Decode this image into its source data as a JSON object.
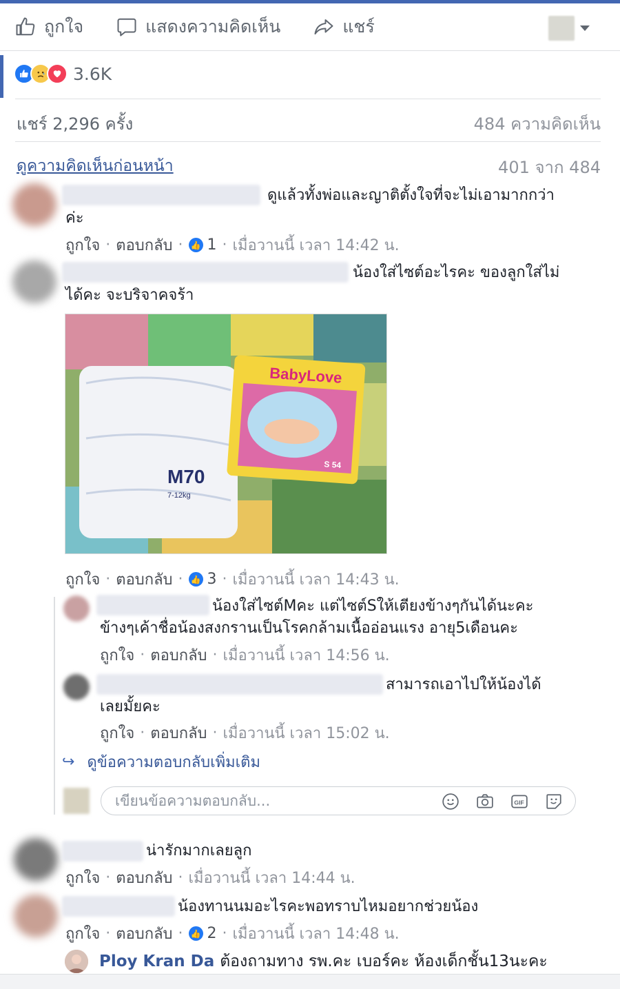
{
  "actions": {
    "like": "ถูกใจ",
    "comment": "แสดงความคิดเห็น",
    "share": "แชร์"
  },
  "reactions": {
    "count": "3.6K"
  },
  "stats": {
    "shares": "แชร์ 2,296 ครั้ง",
    "comments": "484 ความคิดเห็น"
  },
  "pager": {
    "previous": "ดูความคิดเห็นก่อนหน้า",
    "count": "401 จาก 484"
  },
  "comments": [
    {
      "text_line1": "ดูแล้วทั้งพ่อและญาติตั้งใจที่จะไม่เอามากกว่า",
      "text_line2": "ค่ะ",
      "like": "ถูกใจ",
      "reply": "ตอบกลับ",
      "reactions": "1",
      "time": "เมื่อวานนี้ เวลา 14:42 น."
    },
    {
      "text_line1": "น้องใส่ไซต์อะไรคะ ของลูกใส่ไม่",
      "text_line2": "ได้คะ จะบริจาคจร้า",
      "like": "ถูกใจ",
      "reply": "ตอบกลับ",
      "reactions": "3",
      "time": "เมื่อวานนี้ เวลา 14:43 น."
    },
    {
      "text_line1": "น่ารักมากเลยลูก",
      "like": "ถูกใจ",
      "reply": "ตอบกลับ",
      "time": "เมื่อวานนี้ เวลา 14:44 น."
    },
    {
      "text_line1": "น้องทานนมอะไรคะพอทราบไหมอยากช่วยน้อง",
      "like": "ถูกใจ",
      "reply": "ตอบกลับ",
      "reactions": "2",
      "time": "เมื่อวานนี้ เวลา 14:48 น."
    }
  ],
  "replies": [
    {
      "text_line1": "น้องใส่ไซต์Mคะ แต่ไซต์Sให้เตียงข้างๆกันได้นะคะ",
      "text_line2": "ข้างๆเค้าชื่อน้องสงกรานเป็นโรคกล้ามเนื้ออ่อนแรง อายุ5เดือนคะ",
      "like": "ถูกใจ",
      "reply": "ตอบกลับ",
      "time": "เมื่อวานนี้ เวลา 14:56 น."
    },
    {
      "text_line1": "สามารถเอาไปให้น้องได้",
      "text_line2": "เลยมั้ยคะ",
      "like": "ถูกใจ",
      "reply": "ตอบกลับ",
      "time": "เมื่อวานนี้ เวลา 15:02 น."
    }
  ],
  "photo": {
    "brand_text": "BabyLove",
    "size_text": "M70",
    "size_sub": "7-12kg",
    "pack_size": "S 54"
  },
  "more_replies": "ดูข้อความตอบกลับเพิ่มเติม",
  "reply_box": {
    "placeholder": "เขียนข้อความตอบกลับ..."
  },
  "last_comment": {
    "name": "Ploy Kran Da",
    "text": "ต้องถามทาง รพ.คะ เบอร์คะ ห้องเด็กชั้น13นะคะ"
  },
  "colors": {
    "facebook_blue": "#4267b2",
    "link": "#385898",
    "meta_gray": "#90949c"
  }
}
